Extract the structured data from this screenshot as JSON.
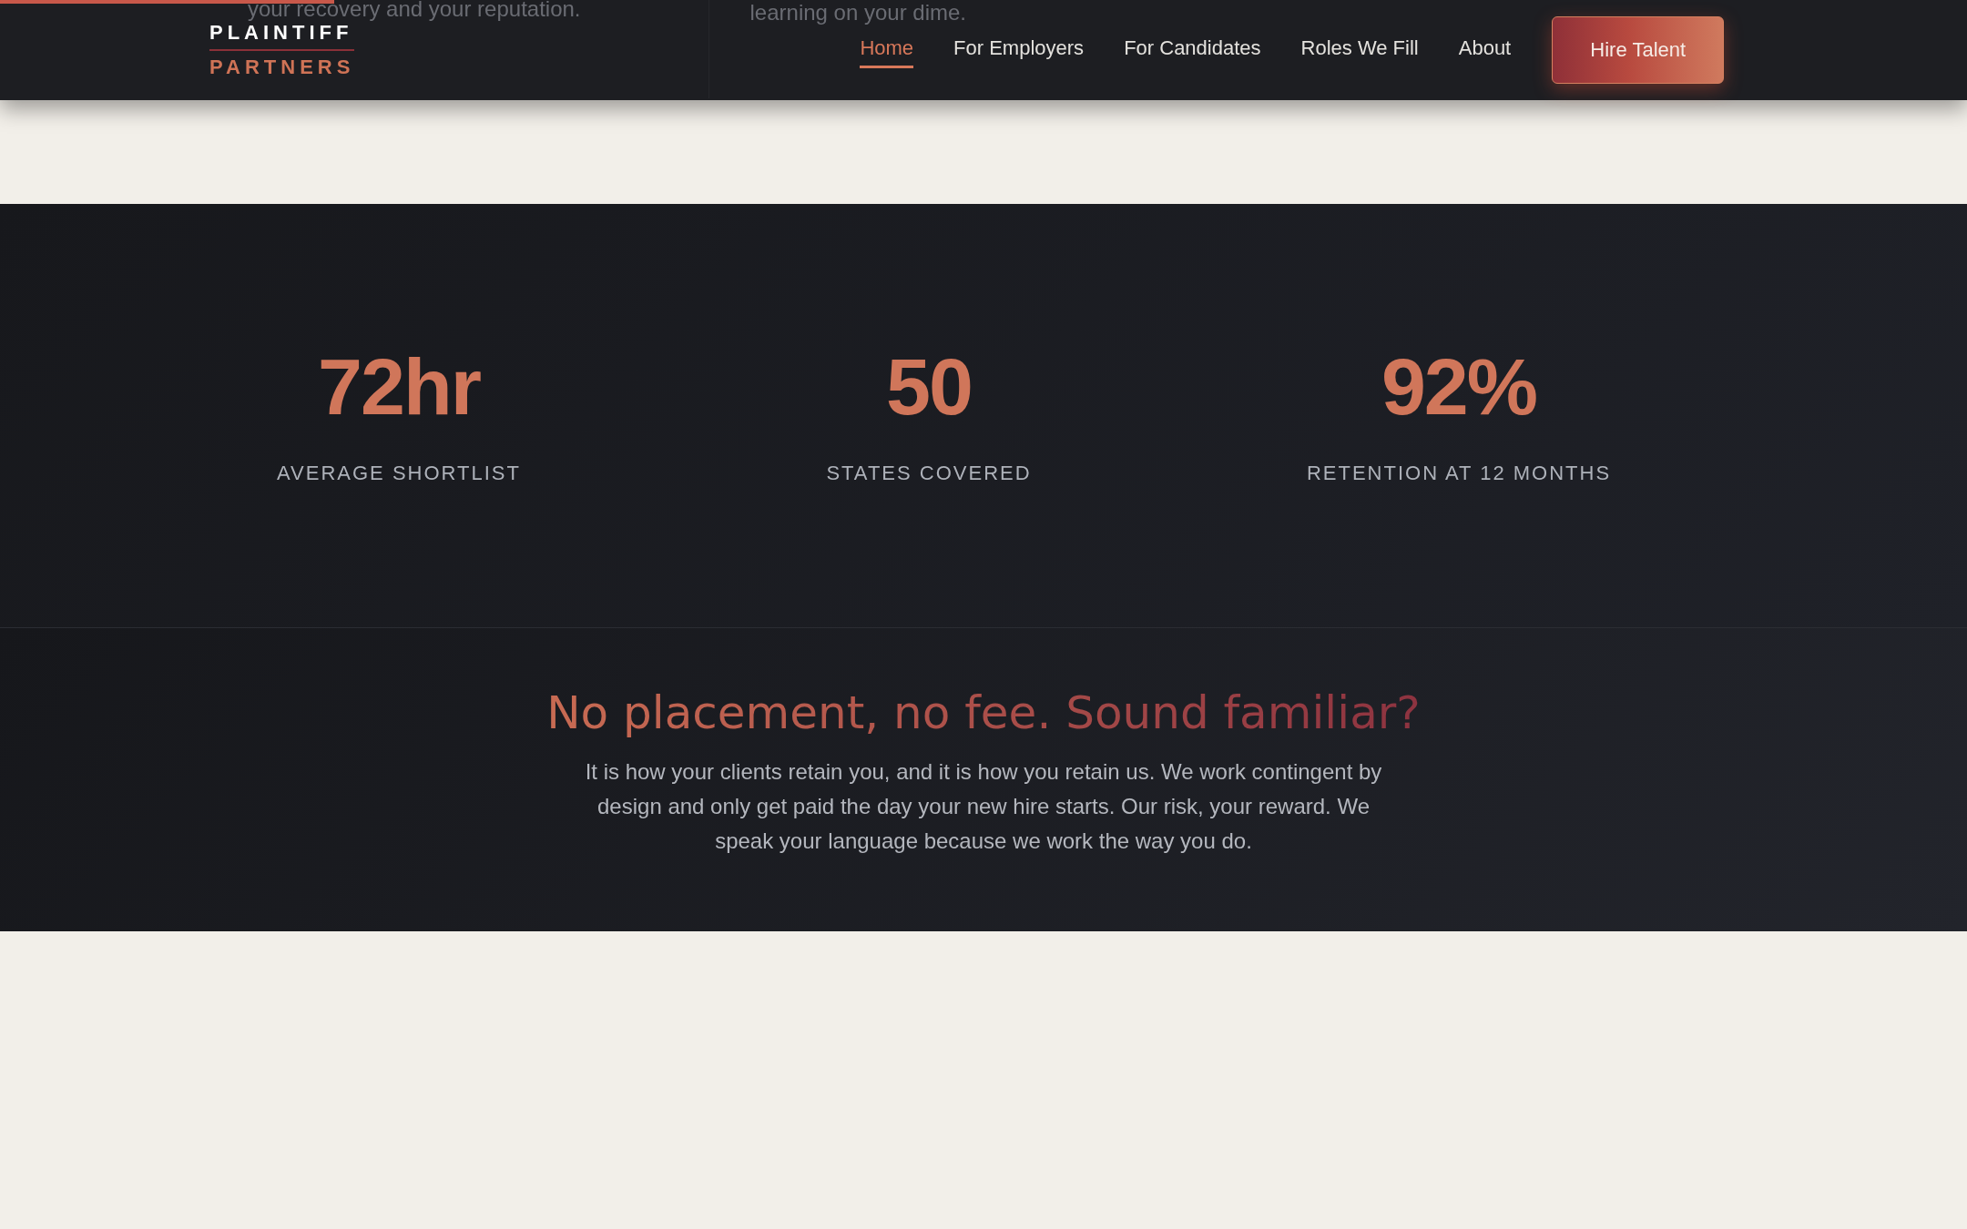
{
  "scroll_progress": {
    "level": 0.17
  },
  "behind_header": [
    "your recovery and your reputation.",
    "learning on your dime."
  ],
  "logo": {
    "line_1": "PLAINTIFF",
    "line_2": "PARTNERS"
  },
  "nav": [
    {
      "label": "Home",
      "selected": true
    },
    {
      "label": "For Employers",
      "selected": false
    },
    {
      "label": "For Candidates",
      "selected": false
    },
    {
      "label": "Roles We Fill",
      "selected": false
    },
    {
      "label": "About",
      "selected": false
    }
  ],
  "cta_button": "Hire Talent",
  "stats": [
    {
      "value": "72hr",
      "label": "AVERAGE SHORTLIST"
    },
    {
      "value": "50",
      "label": "STATES COVERED"
    },
    {
      "value": "92%",
      "label": "RETENTION AT 12 MONTHS"
    }
  ],
  "pitch": {
    "heading": "No placement, no fee. Sound familiar?",
    "body": "It is how your clients retain you, and it is how you retain us. We work contingent by design and only get paid the day your new hire starts. Our risk, your reward. We speak your language because we work the way you do."
  }
}
